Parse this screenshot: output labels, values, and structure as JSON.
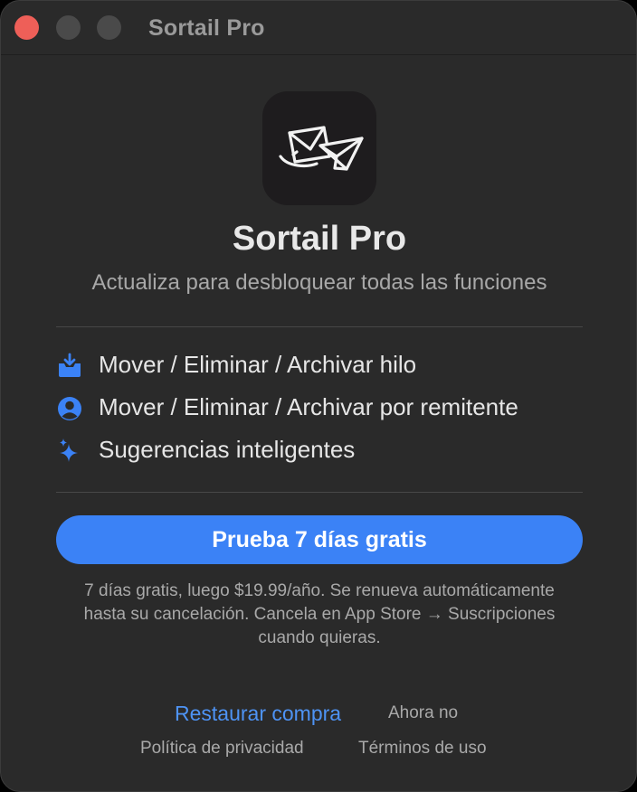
{
  "window": {
    "title": "Sortail Pro"
  },
  "app": {
    "icon": "envelope-paper-plane-icon",
    "name": "Sortail Pro",
    "subtitle": "Actualiza para desbloquear todas las funciones"
  },
  "features": [
    {
      "icon": "inbox-tray-icon",
      "label": "Mover / Eliminar / Archivar hilo"
    },
    {
      "icon": "person-circle-icon",
      "label": "Mover / Eliminar / Archivar por remitente"
    },
    {
      "icon": "sparkles-icon",
      "label": "Sugerencias inteligentes"
    }
  ],
  "cta": {
    "label": "Prueba 7 días gratis"
  },
  "terms": {
    "lines": [
      "7 días gratis, luego $19.99/año. Se renueva automáticamente",
      "hasta su cancelación. Cancela en App Store → Suscripciones",
      "cuando quieras."
    ]
  },
  "links": {
    "restore": "Restaurar compra",
    "not_now": "Ahora no",
    "privacy": "Política de privacidad",
    "terms_of_use": "Términos de uso"
  },
  "colors": {
    "accent": "#3b82f6",
    "link": "#4e93f4",
    "window_bg": "#2a2a2a",
    "close_button": "#ee5f58"
  }
}
